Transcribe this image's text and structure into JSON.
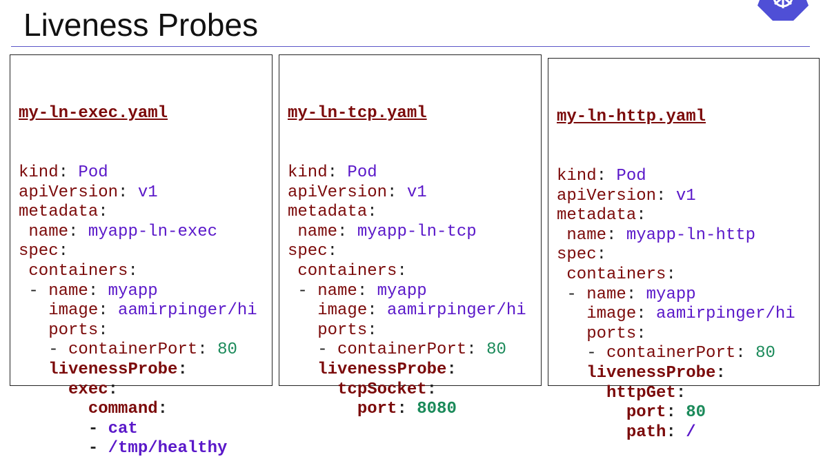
{
  "slide": {
    "title": "Liveness Probes"
  },
  "panels": [
    {
      "filename": "my-ln-exec.yaml",
      "lines": [
        {
          "indent": "",
          "key": "kind",
          "sep": ": ",
          "val": "Pod",
          "vtype": "v",
          "bold": false
        },
        {
          "indent": "",
          "key": "apiVersion",
          "sep": ": ",
          "val": "v1",
          "vtype": "v",
          "bold": false
        },
        {
          "indent": "",
          "key": "metadata",
          "sep": ":",
          "val": "",
          "vtype": "v",
          "bold": false
        },
        {
          "indent": " ",
          "key": "name",
          "sep": ": ",
          "val": "myapp-ln-exec",
          "vtype": "v",
          "bold": false
        },
        {
          "indent": "",
          "key": "spec",
          "sep": ":",
          "val": "",
          "vtype": "v",
          "bold": false
        },
        {
          "indent": " ",
          "key": "containers",
          "sep": ":",
          "val": "",
          "vtype": "v",
          "bold": false
        },
        {
          "indent": " - ",
          "key": "name",
          "sep": ": ",
          "val": "myapp",
          "vtype": "v",
          "bold": false
        },
        {
          "indent": "   ",
          "key": "image",
          "sep": ": ",
          "val": "aamirpinger/hi",
          "vtype": "v",
          "bold": false
        },
        {
          "indent": "   ",
          "key": "ports",
          "sep": ":",
          "val": "",
          "vtype": "v",
          "bold": false
        },
        {
          "indent": "   - ",
          "key": "containerPort",
          "sep": ": ",
          "val": "80",
          "vtype": "n",
          "bold": false
        },
        {
          "indent": "   ",
          "key": "livenessProbe",
          "sep": ":",
          "val": "",
          "vtype": "v",
          "bold": true
        },
        {
          "indent": "     ",
          "key": "exec",
          "sep": ":",
          "val": "",
          "vtype": "v",
          "bold": true
        },
        {
          "indent": "       ",
          "key": "command",
          "sep": ":",
          "val": "",
          "vtype": "v",
          "bold": true
        },
        {
          "indent": "       - ",
          "key": "",
          "sep": "",
          "val": "cat",
          "vtype": "v",
          "bold": true
        },
        {
          "indent": "       - ",
          "key": "",
          "sep": "",
          "val": "/tmp/healthy",
          "vtype": "v",
          "bold": true
        }
      ]
    },
    {
      "filename": "my-ln-tcp.yaml",
      "lines": [
        {
          "indent": "",
          "key": "kind",
          "sep": ": ",
          "val": "Pod",
          "vtype": "v",
          "bold": false
        },
        {
          "indent": "",
          "key": "apiVersion",
          "sep": ": ",
          "val": "v1",
          "vtype": "v",
          "bold": false
        },
        {
          "indent": "",
          "key": "metadata",
          "sep": ":",
          "val": "",
          "vtype": "v",
          "bold": false
        },
        {
          "indent": " ",
          "key": "name",
          "sep": ": ",
          "val": "myapp-ln-tcp",
          "vtype": "v",
          "bold": false
        },
        {
          "indent": "",
          "key": "spec",
          "sep": ":",
          "val": "",
          "vtype": "v",
          "bold": false
        },
        {
          "indent": " ",
          "key": "containers",
          "sep": ":",
          "val": "",
          "vtype": "v",
          "bold": false
        },
        {
          "indent": " - ",
          "key": "name",
          "sep": ": ",
          "val": "myapp",
          "vtype": "v",
          "bold": false
        },
        {
          "indent": "   ",
          "key": "image",
          "sep": ": ",
          "val": "aamirpinger/hi",
          "vtype": "v",
          "bold": false
        },
        {
          "indent": "   ",
          "key": "ports",
          "sep": ":",
          "val": "",
          "vtype": "v",
          "bold": false
        },
        {
          "indent": "   - ",
          "key": "containerPort",
          "sep": ": ",
          "val": "80",
          "vtype": "n",
          "bold": false
        },
        {
          "indent": "   ",
          "key": "livenessProbe",
          "sep": ":",
          "val": "",
          "vtype": "v",
          "bold": true
        },
        {
          "indent": "     ",
          "key": "tcpSocket",
          "sep": ":",
          "val": "",
          "vtype": "v",
          "bold": true
        },
        {
          "indent": "       ",
          "key": "port",
          "sep": ": ",
          "val": "8080",
          "vtype": "n",
          "bold": true
        }
      ]
    },
    {
      "filename": "my-ln-http.yaml",
      "lines": [
        {
          "indent": "",
          "key": "kind",
          "sep": ": ",
          "val": "Pod",
          "vtype": "v",
          "bold": false
        },
        {
          "indent": "",
          "key": "apiVersion",
          "sep": ": ",
          "val": "v1",
          "vtype": "v",
          "bold": false
        },
        {
          "indent": "",
          "key": "metadata",
          "sep": ":",
          "val": "",
          "vtype": "v",
          "bold": false
        },
        {
          "indent": " ",
          "key": "name",
          "sep": ": ",
          "val": "myapp-ln-http",
          "vtype": "v",
          "bold": false
        },
        {
          "indent": "",
          "key": "spec",
          "sep": ":",
          "val": "",
          "vtype": "v",
          "bold": false
        },
        {
          "indent": " ",
          "key": "containers",
          "sep": ":",
          "val": "",
          "vtype": "v",
          "bold": false
        },
        {
          "indent": " - ",
          "key": "name",
          "sep": ": ",
          "val": "myapp",
          "vtype": "v",
          "bold": false
        },
        {
          "indent": "   ",
          "key": "image",
          "sep": ": ",
          "val": "aamirpinger/hi",
          "vtype": "v",
          "bold": false
        },
        {
          "indent": "   ",
          "key": "ports",
          "sep": ":",
          "val": "",
          "vtype": "v",
          "bold": false
        },
        {
          "indent": "   - ",
          "key": "containerPort",
          "sep": ": ",
          "val": "80",
          "vtype": "n",
          "bold": false
        },
        {
          "indent": "   ",
          "key": "livenessProbe",
          "sep": ":",
          "val": "",
          "vtype": "v",
          "bold": true
        },
        {
          "indent": "     ",
          "key": "httpGet",
          "sep": ":",
          "val": "",
          "vtype": "v",
          "bold": true
        },
        {
          "indent": "       ",
          "key": "port",
          "sep": ": ",
          "val": "80",
          "vtype": "n",
          "bold": true
        },
        {
          "indent": "       ",
          "key": "path",
          "sep": ": ",
          "val": "/",
          "vtype": "v",
          "bold": true
        }
      ]
    }
  ],
  "icons": {
    "logo": "kubernetes-helm-icon"
  },
  "colors": {
    "key": "#7b0a0a",
    "value": "#5a18c9",
    "number": "#1b8a5a",
    "rule": "#5a55c8"
  }
}
